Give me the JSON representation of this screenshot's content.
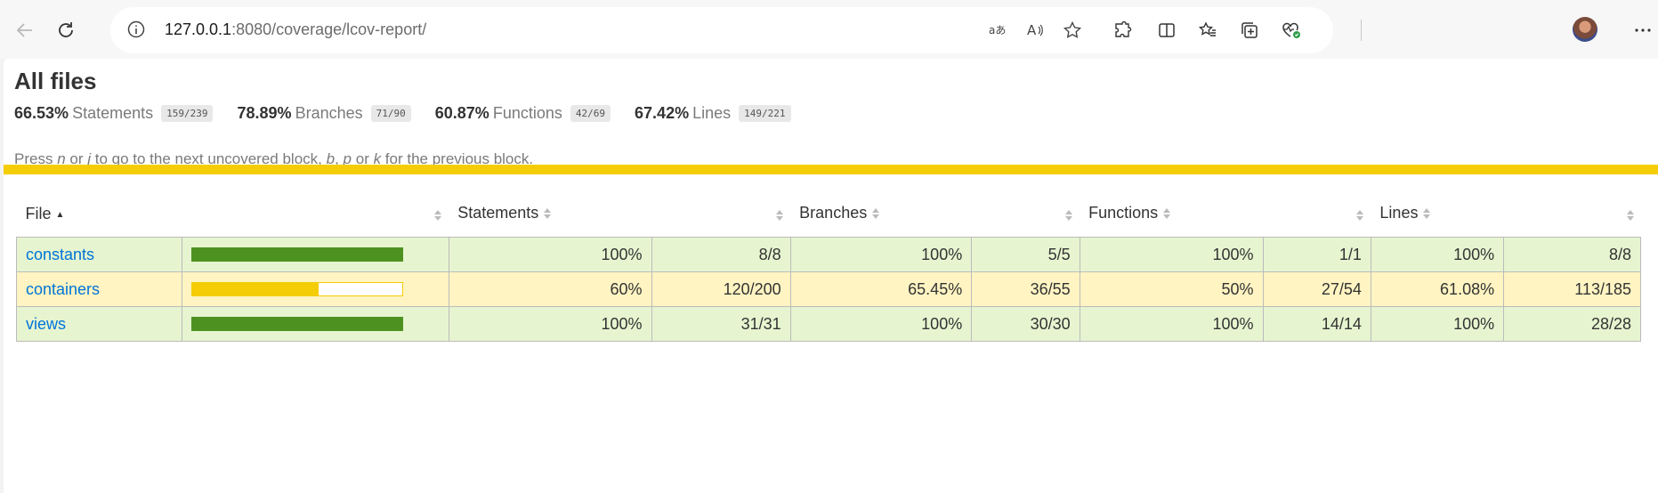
{
  "browser": {
    "url_host": "127.0.0.1",
    "url_rest": ":8080/coverage/lcov-report/",
    "icons": [
      "back-arrow-icon",
      "refresh-icon",
      "site-info-icon",
      "translate-icon",
      "read-aloud-icon",
      "favorite-star-icon",
      "extensions-icon",
      "split-screen-icon",
      "favorites-icon",
      "collections-icon",
      "browser-essentials-icon",
      "profile-avatar",
      "more-options-icon"
    ]
  },
  "page": {
    "title": "All files",
    "summary": [
      {
        "pct": "66.53%",
        "label": "Statements",
        "fraction": "159/239"
      },
      {
        "pct": "78.89%",
        "label": "Branches",
        "fraction": "71/90"
      },
      {
        "pct": "60.87%",
        "label": "Functions",
        "fraction": "42/69"
      },
      {
        "pct": "67.42%",
        "label": "Lines",
        "fraction": "149/221"
      }
    ],
    "hint": {
      "t1": "Press ",
      "k1": "n",
      "t2": " or ",
      "k2": "j",
      "t3": " to go to the next uncovered block, ",
      "k3": "b",
      "t4": ", ",
      "k4": "p",
      "t5": " or ",
      "k5": "k",
      "t6": " for the previous block."
    },
    "status_color": "#f5cd07"
  },
  "table": {
    "headers": {
      "file": "File",
      "statements": "Statements",
      "branches": "Branches",
      "functions": "Functions",
      "lines": "Lines"
    },
    "sort_indicator": "▲",
    "colors": {
      "high_bg": "#e6f5d0",
      "medium_bg": "#fff4c2",
      "high_bar": "#4d9221",
      "medium_bar": "#f5cd07"
    },
    "rows": [
      {
        "file": "constants",
        "level": "high",
        "coverage": 1.0,
        "statements_pct": "100%",
        "statements_frac": "8/8",
        "branches_pct": "100%",
        "branches_frac": "5/5",
        "functions_pct": "100%",
        "functions_frac": "1/1",
        "lines_pct": "100%",
        "lines_frac": "8/8"
      },
      {
        "file": "containers",
        "level": "medium",
        "coverage": 0.6,
        "statements_pct": "60%",
        "statements_frac": "120/200",
        "branches_pct": "65.45%",
        "branches_frac": "36/55",
        "functions_pct": "50%",
        "functions_frac": "27/54",
        "lines_pct": "61.08%",
        "lines_frac": "113/185"
      },
      {
        "file": "views",
        "level": "high",
        "coverage": 1.0,
        "statements_pct": "100%",
        "statements_frac": "31/31",
        "branches_pct": "100%",
        "branches_frac": "30/30",
        "functions_pct": "100%",
        "functions_frac": "14/14",
        "lines_pct": "100%",
        "lines_frac": "28/28"
      }
    ]
  }
}
